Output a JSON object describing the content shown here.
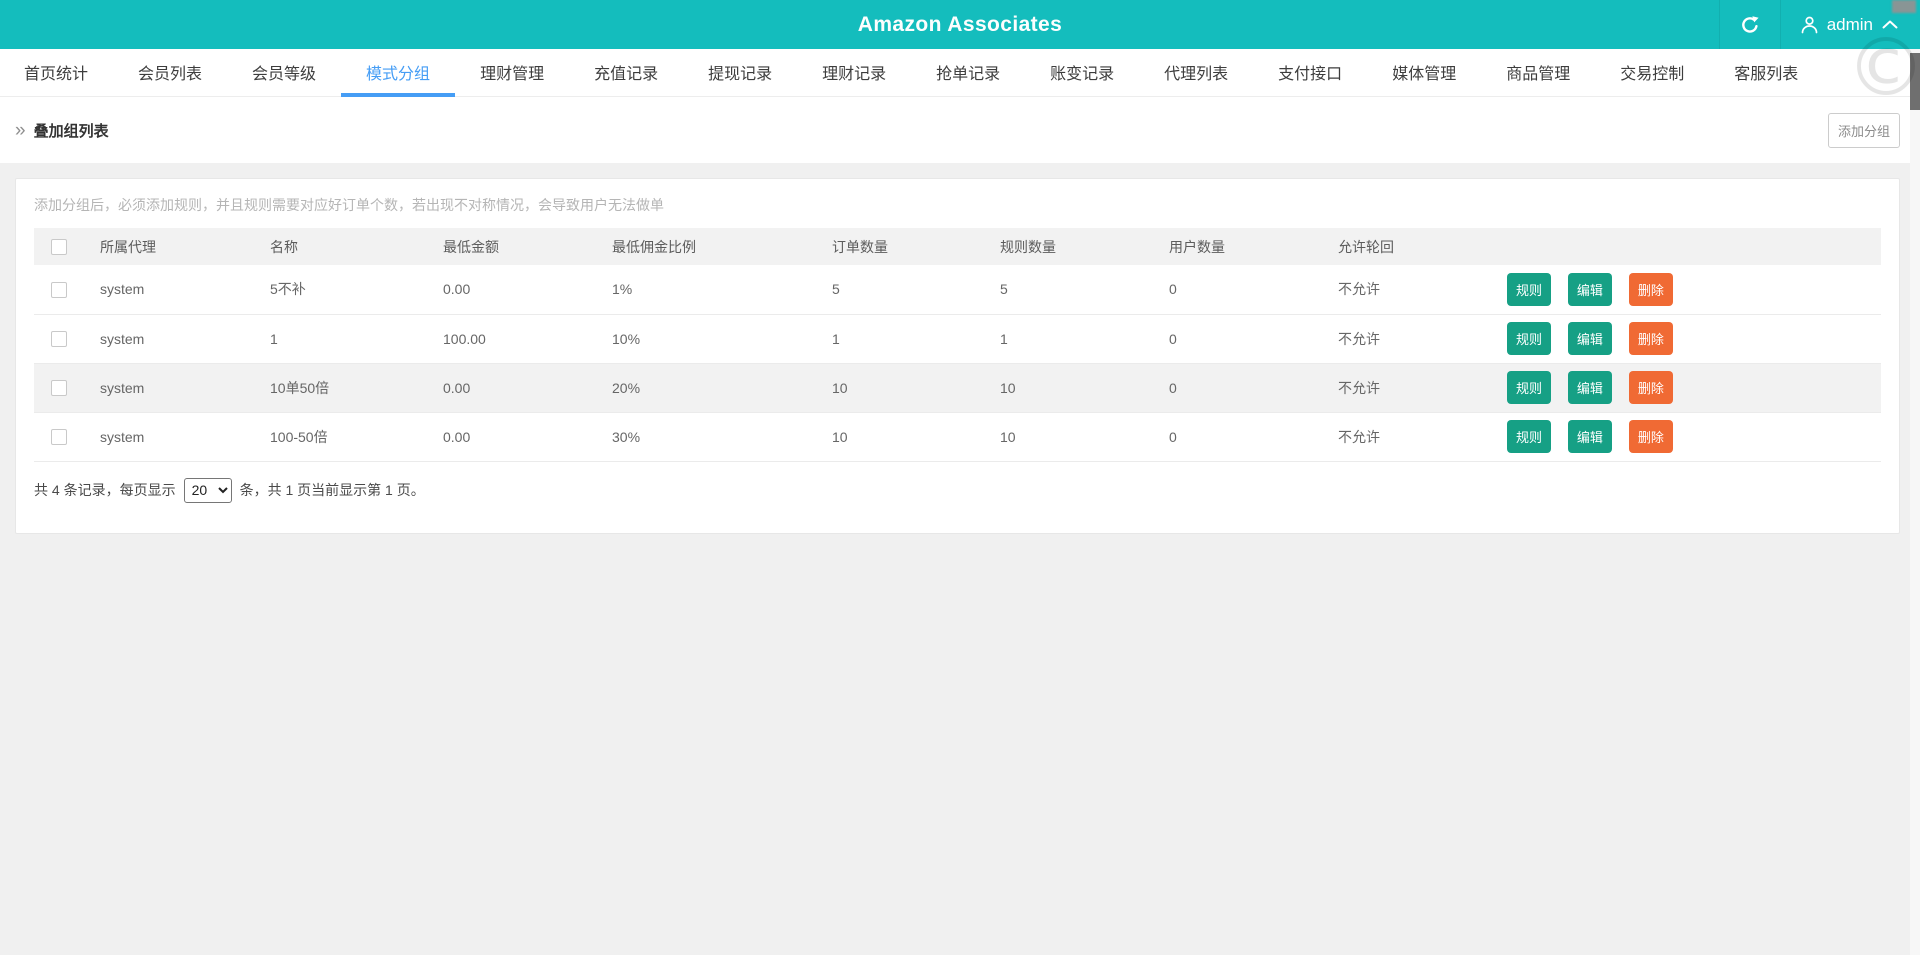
{
  "colors": {
    "teal": "#14bdbd",
    "blue": "#459df5",
    "green": "#16a085",
    "orange": "#f06a34"
  },
  "header": {
    "title": "Amazon Associates",
    "user": "admin"
  },
  "nav": {
    "items": [
      {
        "key": "home-stats",
        "label": "首页统计",
        "active": false
      },
      {
        "key": "member-list",
        "label": "会员列表",
        "active": false
      },
      {
        "key": "member-level",
        "label": "会员等级",
        "active": false
      },
      {
        "key": "mode-group",
        "label": "模式分组",
        "active": true
      },
      {
        "key": "finance-mgmt",
        "label": "理财管理",
        "active": false
      },
      {
        "key": "recharge-records",
        "label": "充值记录",
        "active": false
      },
      {
        "key": "withdraw-records",
        "label": "提现记录",
        "active": false
      },
      {
        "key": "finance-records",
        "label": "理财记录",
        "active": false
      },
      {
        "key": "grab-order-records",
        "label": "抢单记录",
        "active": false
      },
      {
        "key": "account-change-records",
        "label": "账变记录",
        "active": false
      },
      {
        "key": "agent-list",
        "label": "代理列表",
        "active": false
      },
      {
        "key": "payment-api",
        "label": "支付接口",
        "active": false
      },
      {
        "key": "media-mgmt",
        "label": "媒体管理",
        "active": false
      },
      {
        "key": "product-mgmt",
        "label": "商品管理",
        "active": false
      },
      {
        "key": "trade-control",
        "label": "交易控制",
        "active": false
      },
      {
        "key": "service-list",
        "label": "客服列表",
        "active": false
      }
    ]
  },
  "breadcrumb": {
    "title": "叠加组列表",
    "add_button": "添加分组"
  },
  "panel": {
    "hint": "添加分组后，必须添加规则，并且规则需要对应好订单个数，若出现不对称情况，会导致用户无法做单",
    "table": {
      "headers": [
        "所属代理",
        "名称",
        "最低金额",
        "最低佣金比例",
        "订单数量",
        "规则数量",
        "用户数量",
        "允许轮回"
      ],
      "actions": {
        "rule": "规则",
        "edit": "编辑",
        "delete": "删除"
      },
      "rows": [
        {
          "agent": "system",
          "name": "5不补",
          "min_amount": "0.00",
          "min_commission": "1%",
          "orders": "5",
          "rules": "5",
          "users": "0",
          "loop": "不允许",
          "striped": false
        },
        {
          "agent": "system",
          "name": "1",
          "min_amount": "100.00",
          "min_commission": "10%",
          "orders": "1",
          "rules": "1",
          "users": "0",
          "loop": "不允许",
          "striped": false
        },
        {
          "agent": "system",
          "name": "10单50倍",
          "min_amount": "0.00",
          "min_commission": "20%",
          "orders": "10",
          "rules": "10",
          "users": "0",
          "loop": "不允许",
          "striped": true
        },
        {
          "agent": "system",
          "name": "100-50倍",
          "min_amount": "0.00",
          "min_commission": "30%",
          "orders": "10",
          "rules": "10",
          "users": "0",
          "loop": "不允许",
          "striped": false
        }
      ]
    },
    "pagination": {
      "prefix": "共 4 条记录，每页显示",
      "page_size": "20",
      "suffix": "条，共 1 页当前显示第 1 页。"
    }
  },
  "watermark": "©"
}
